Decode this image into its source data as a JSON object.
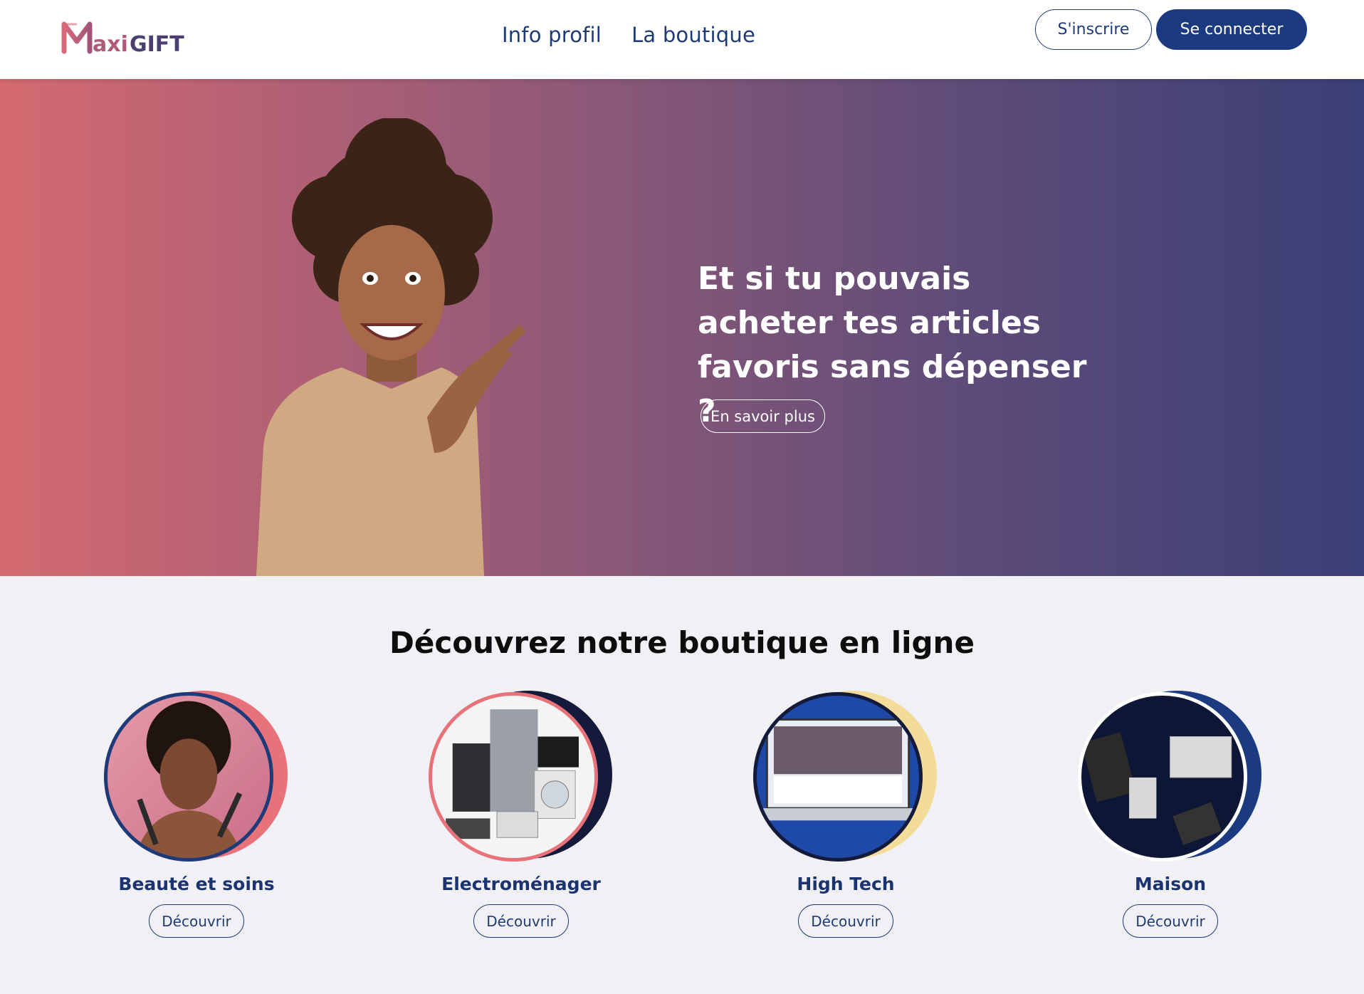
{
  "header": {
    "logo_text": "Maxigift",
    "nav": [
      "Info profil",
      "La boutique"
    ],
    "signup_label": "S'inscrire",
    "login_label": "Se connecter"
  },
  "hero": {
    "title": "Et si tu pouvais acheter tes articles favoris sans dépenser ?",
    "button_label": "En savoir plus"
  },
  "section": {
    "title": "Découvrez notre boutique en ligne",
    "categories": [
      {
        "label": "Beauté et soins",
        "button": "Découvrir",
        "accent": "#e8727a",
        "border": "#1e3a78"
      },
      {
        "label": "Electroménager",
        "button": "Découvrir",
        "accent": "#131a3a",
        "border": "#e8727a"
      },
      {
        "label": "High Tech",
        "button": "Découvrir",
        "accent": "#f3dc9a",
        "border": "#131a3a"
      },
      {
        "label": "Maison",
        "button": "Découvrir",
        "accent": "#1b3a80",
        "border": "#ffffff"
      }
    ]
  },
  "colors": {
    "brand_navy": "#1b3a80",
    "brand_pink": "#d46a70"
  }
}
